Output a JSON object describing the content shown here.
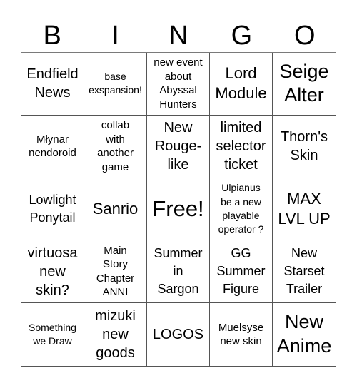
{
  "header": {
    "letters": [
      "B",
      "I",
      "N",
      "G",
      "O"
    ]
  },
  "board": {
    "rows": [
      [
        "Endfield\nNews",
        "base\nexspansion!",
        "new event\nabout\nAbyssal\nHunters",
        "Lord\nModule",
        "Seige\nAlter"
      ],
      [
        "Młynar\nnendoroid",
        "collab\nwith\nanother\ngame",
        "New\nRouge-\nlike",
        "limited\nselector\nticket",
        "Thorn's\nSkin"
      ],
      [
        "Lowlight\nPonytail",
        "Sanrio",
        "Free!",
        "Ulpianus\nbe   a new\nplayable\noperator ?",
        "MAX\nLVL UP"
      ],
      [
        "virtuosa\nnew\nskin?",
        "Main\nStory\nChapter\nANNI",
        "Summer\nin\nSargon",
        "GG\nSummer\nFigure",
        "New\nStarset\nTrailer"
      ],
      [
        "Something\nwe Draw",
        "mizuki\nnew\ngoods",
        "LOGOS",
        "Muelsyse\nnew skin",
        "New\nAnime"
      ]
    ]
  }
}
